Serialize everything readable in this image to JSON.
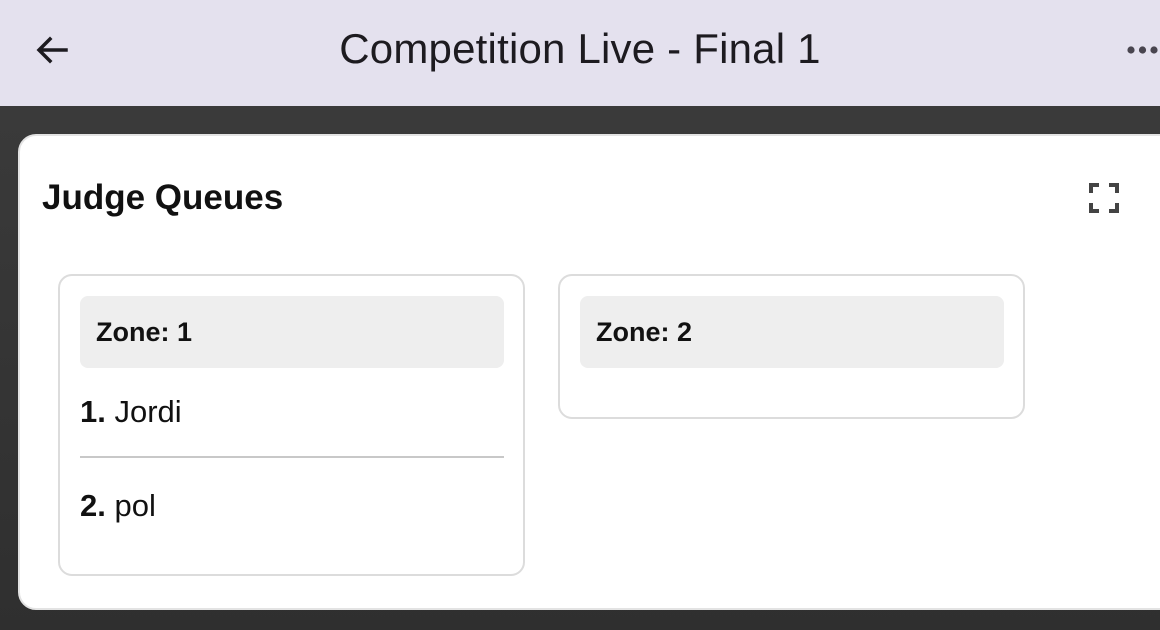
{
  "app_bar": {
    "title": "Competition Live - Final 1",
    "back_icon": "arrow-left-icon",
    "more_icon": "more-horizontal-icon"
  },
  "panel": {
    "title": "Judge Queues",
    "expand_icon": "fullscreen-icon"
  },
  "zones": [
    {
      "header": "Zone: 1",
      "queue": [
        {
          "number": "1.",
          "name": "Jordi"
        },
        {
          "number": "2.",
          "name": "pol"
        }
      ]
    },
    {
      "header": "Zone: 2",
      "queue": []
    }
  ],
  "colors": {
    "app_bar": "#e4e1ee",
    "background": "#333333",
    "card": "#ffffff",
    "zone_header": "#eeeeee"
  }
}
